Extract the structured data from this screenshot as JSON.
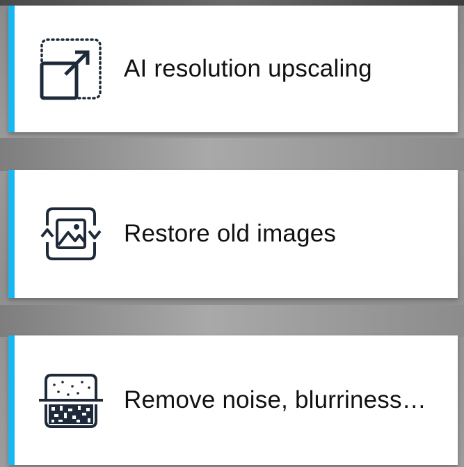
{
  "features": [
    {
      "id": "upscale",
      "label": "AI resolution upscaling",
      "icon": "upscale-icon"
    },
    {
      "id": "restore",
      "label": "Restore old images",
      "icon": "restore-image-icon"
    },
    {
      "id": "denoise",
      "label": "Remove noise, blurriness…",
      "icon": "denoise-icon"
    }
  ],
  "colors": {
    "accent": "#19b7f2",
    "card_background": "#ffffff",
    "text": "#111111",
    "icon_stroke": "#1e2a3a"
  }
}
